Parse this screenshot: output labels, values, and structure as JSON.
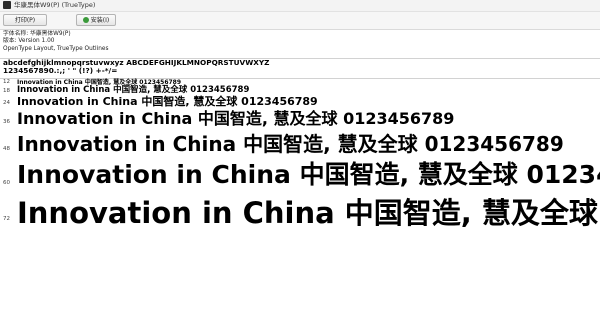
{
  "window": {
    "title": "华康黑体W9(P) (TrueType)"
  },
  "toolbar": {
    "print_label": "打印(P)",
    "install_label": "安装(I)"
  },
  "info": {
    "font_name": "字体名称: 华康黑体W9(P)",
    "version": "版本: Version 1.00",
    "outline": "OpenType Layout, TrueType Outlines"
  },
  "charset": {
    "line1": "abcdefghijklmnopqrstuvwxyz ABCDEFGHIJKLMNOPQRSTUVWXYZ",
    "line2": "1234567890.:,; ' \" (!?) +-*/="
  },
  "samples": {
    "text": "Innovation in China 中国智造, 慧及全球 0123456789",
    "sizes": [
      "12",
      "18",
      "24",
      "36",
      "48",
      "60",
      "72"
    ]
  }
}
